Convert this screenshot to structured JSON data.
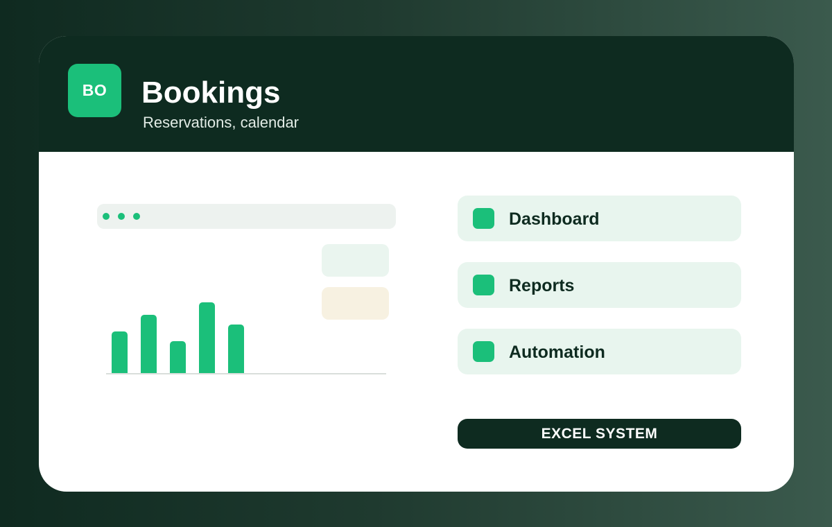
{
  "app": {
    "logo_text": "BO",
    "title": "Bookings",
    "subtitle": "Reservations, calendar"
  },
  "menu": {
    "items": [
      {
        "label": "Dashboard",
        "icon": "square-icon"
      },
      {
        "label": "Reports",
        "icon": "square-icon"
      },
      {
        "label": "Automation",
        "icon": "square-icon"
      }
    ]
  },
  "cta": {
    "label": "EXCEL SYSTEM"
  },
  "preview_chart": {
    "values": [
      60,
      84,
      46,
      102,
      70
    ]
  },
  "colors": {
    "accent": "#1bbf7a",
    "header": "#0e2b20",
    "card": "#ffffff",
    "menu_bg": "#e8f5ee"
  }
}
